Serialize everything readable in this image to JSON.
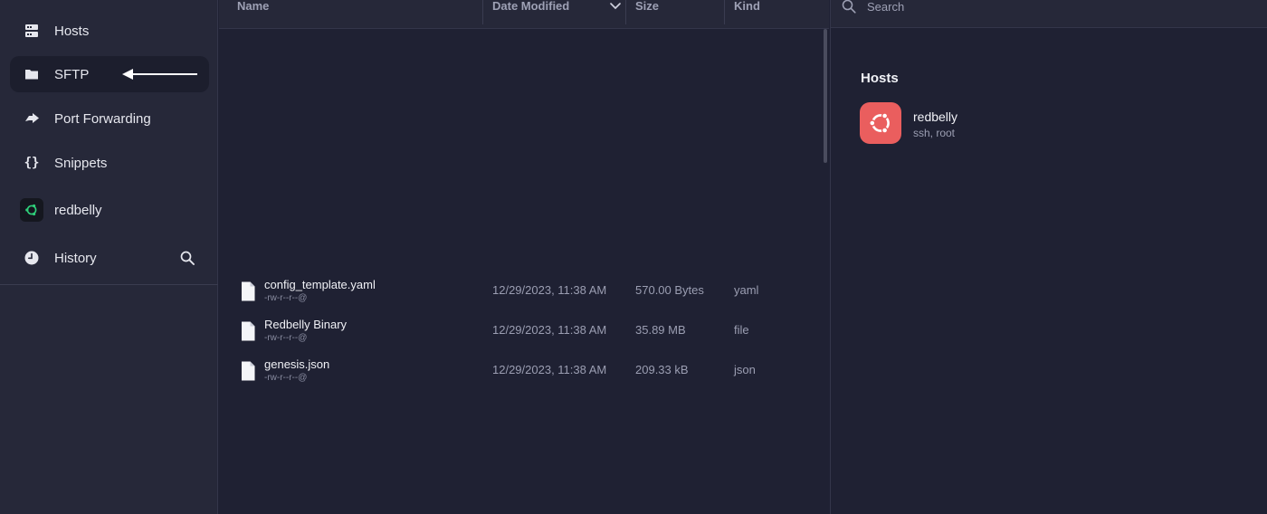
{
  "sidebar": {
    "items": [
      {
        "label": "Hosts",
        "icon": "server-icon"
      },
      {
        "label": "SFTP",
        "icon": "folder-icon",
        "active": true
      },
      {
        "label": "Port Forwarding",
        "icon": "port-forward-icon"
      },
      {
        "label": "Snippets",
        "icon": "braces-icon"
      },
      {
        "label": "redbelly",
        "icon": "ubuntu-icon"
      },
      {
        "label": "History",
        "icon": "clock-icon"
      }
    ]
  },
  "files": {
    "columns": [
      "Name",
      "Date Modified",
      "Size",
      "Kind"
    ],
    "rows": [
      {
        "name": "config_template.yaml",
        "perm": "-rw-r--r--@",
        "date": "12/29/2023, 11:38 AM",
        "size": "570.00 Bytes",
        "kind": "yaml"
      },
      {
        "name": "Redbelly Binary",
        "perm": "-rw-r--r--@",
        "date": "12/29/2023, 11:38 AM",
        "size": "35.89 MB",
        "kind": "file"
      },
      {
        "name": "genesis.json",
        "perm": "-rw-r--r--@",
        "date": "12/29/2023, 11:38 AM",
        "size": "209.33 kB",
        "kind": "json"
      }
    ]
  },
  "right_panel": {
    "search_placeholder": "Search",
    "hosts_title": "Hosts",
    "host": {
      "name": "redbelly",
      "subtitle": "ssh, root"
    }
  },
  "colors": {
    "accent_green": "#2fd07a",
    "host_avatar": "#ea5e5e",
    "background": "#1f2133",
    "sidebar": "#262839"
  }
}
